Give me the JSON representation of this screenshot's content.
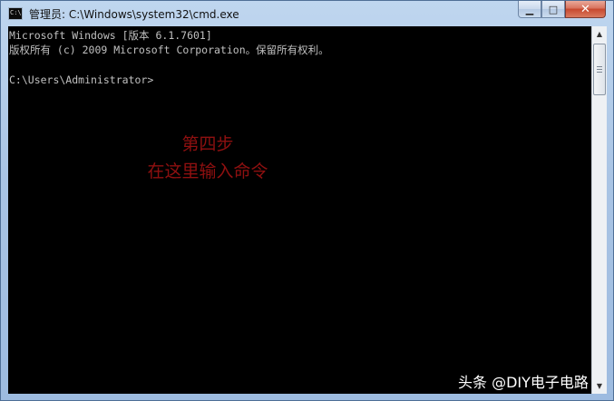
{
  "window": {
    "title": "管理员: C:\\Windows\\system32\\cmd.exe",
    "app_icon_text": "C:\\",
    "buttons": {
      "minimize_glyph": "▁",
      "maximize_glyph": "□",
      "close_glyph": "✕"
    }
  },
  "console": {
    "lines": [
      "Microsoft Windows [版本 6.1.7601]",
      "版权所有 (c) 2009 Microsoft Corporation。保留所有权利。",
      "",
      "C:\\Users\\Administrator>"
    ]
  },
  "annotation": {
    "line1": "第四步",
    "line2": "在这里输入命令",
    "color": "#8f1010"
  },
  "watermark": "头条 @DIY电子电路",
  "scrollbar": {
    "up_glyph": "▲",
    "down_glyph": "▼"
  }
}
